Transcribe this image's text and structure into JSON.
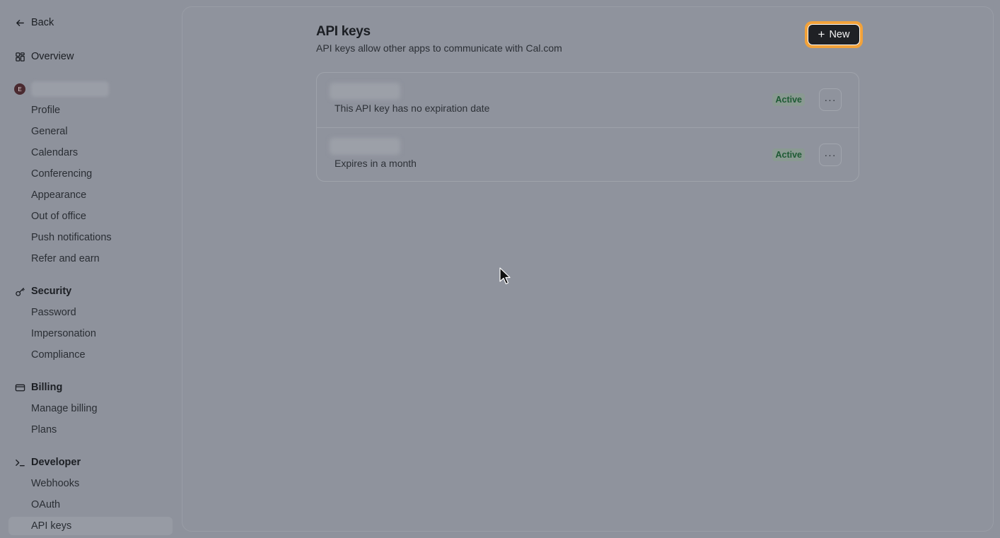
{
  "sidebar": {
    "back_label": "Back",
    "overview_label": "Overview",
    "account": {
      "avatar_initial": "E",
      "items": [
        "Profile",
        "General",
        "Calendars",
        "Conferencing",
        "Appearance",
        "Out of office",
        "Push notifications",
        "Refer and earn"
      ]
    },
    "security": {
      "label": "Security",
      "items": [
        "Password",
        "Impersonation",
        "Compliance"
      ]
    },
    "billing": {
      "label": "Billing",
      "items": [
        "Manage billing",
        "Plans"
      ]
    },
    "developer": {
      "label": "Developer",
      "items": [
        "Webhooks",
        "OAuth",
        "API keys"
      ]
    }
  },
  "main": {
    "title": "API keys",
    "subtitle": "API keys allow other apps to communicate with Cal.com",
    "new_button_label": "New",
    "keys": [
      {
        "description": "This API key has no expiration date",
        "status": "Active"
      },
      {
        "description": "Expires in a month",
        "status": "Active"
      }
    ],
    "more_label": "···"
  },
  "colors": {
    "highlight": "#f2a23a",
    "primary_button": "#1f2125",
    "active_badge_text": "#1e5a34"
  }
}
